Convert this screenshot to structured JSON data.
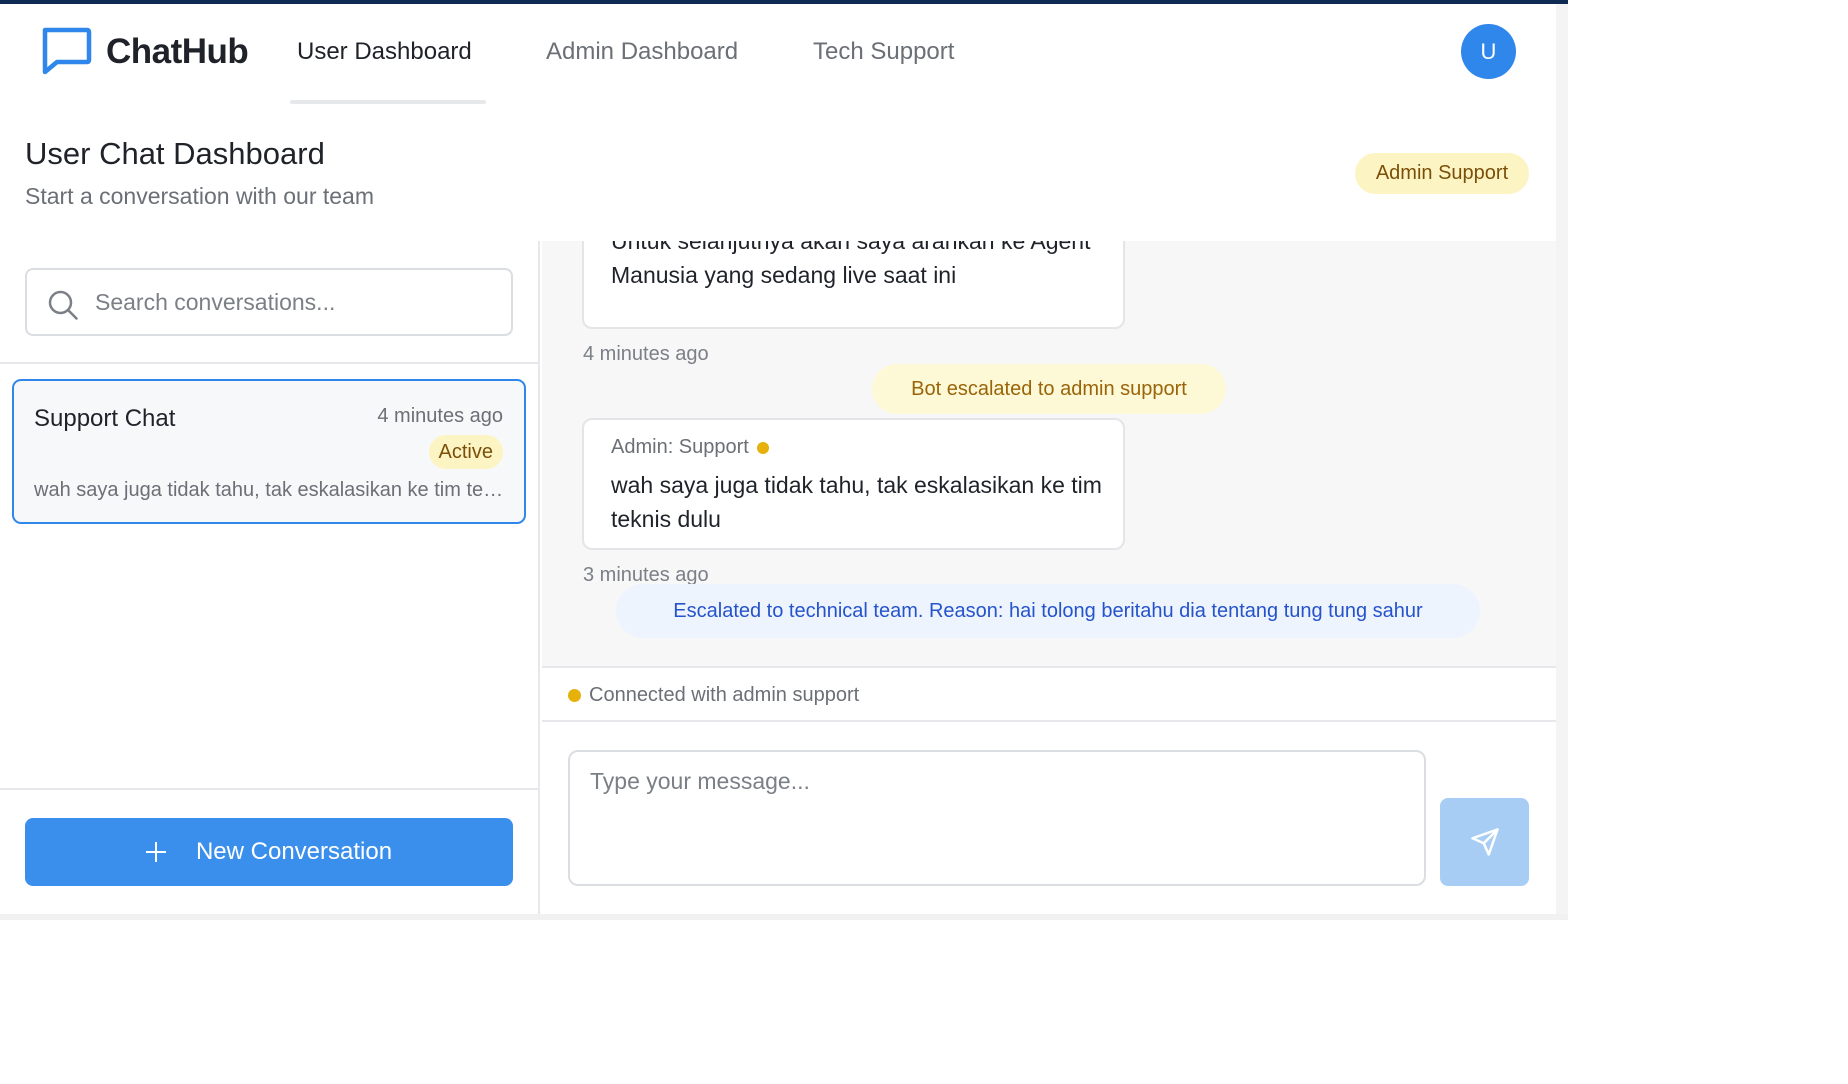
{
  "app": {
    "brand": "ChatHub",
    "avatar_initial": "U"
  },
  "nav": {
    "tabs": [
      {
        "label": "User Dashboard",
        "active": true
      },
      {
        "label": "Admin Dashboard",
        "active": false
      },
      {
        "label": "Tech Support",
        "active": false
      }
    ]
  },
  "page": {
    "title": "User Chat Dashboard",
    "subtitle": "Start a conversation with our team",
    "support_badge": "Admin Support"
  },
  "sidebar": {
    "search_placeholder": "Search conversations...",
    "conversations": [
      {
        "title": "Support Chat",
        "time": "4 minutes ago",
        "status": "Active",
        "preview": "wah saya juga tidak tahu, tak eskalasikan ke tim teknis dulu"
      }
    ],
    "new_button_label": "New Conversation"
  },
  "chat": {
    "messages": [
      {
        "text": "Untuk selanjutnya akan saya arahkan ke Agent Manusia yang sedang live saat ini",
        "time": "4 minutes ago"
      },
      {
        "author": "Admin: Support",
        "text": "wah saya juga tidak tahu, tak eskalasikan ke tim teknis dulu",
        "time": "3 minutes ago"
      }
    ],
    "system_events": [
      "Bot escalated to admin support",
      "Escalated to technical team. Reason: hai tolong beritahu dia tentang tung tung sahur"
    ],
    "connection_status": "Connected with admin support",
    "input_placeholder": "Type your message..."
  },
  "colors": {
    "accent": "#3b8fec",
    "active_border": "#2f86eb",
    "status_yellow": "#e5b10a",
    "badge_bg": "#fdf4c4",
    "escalation_blue": "#2553cc"
  }
}
